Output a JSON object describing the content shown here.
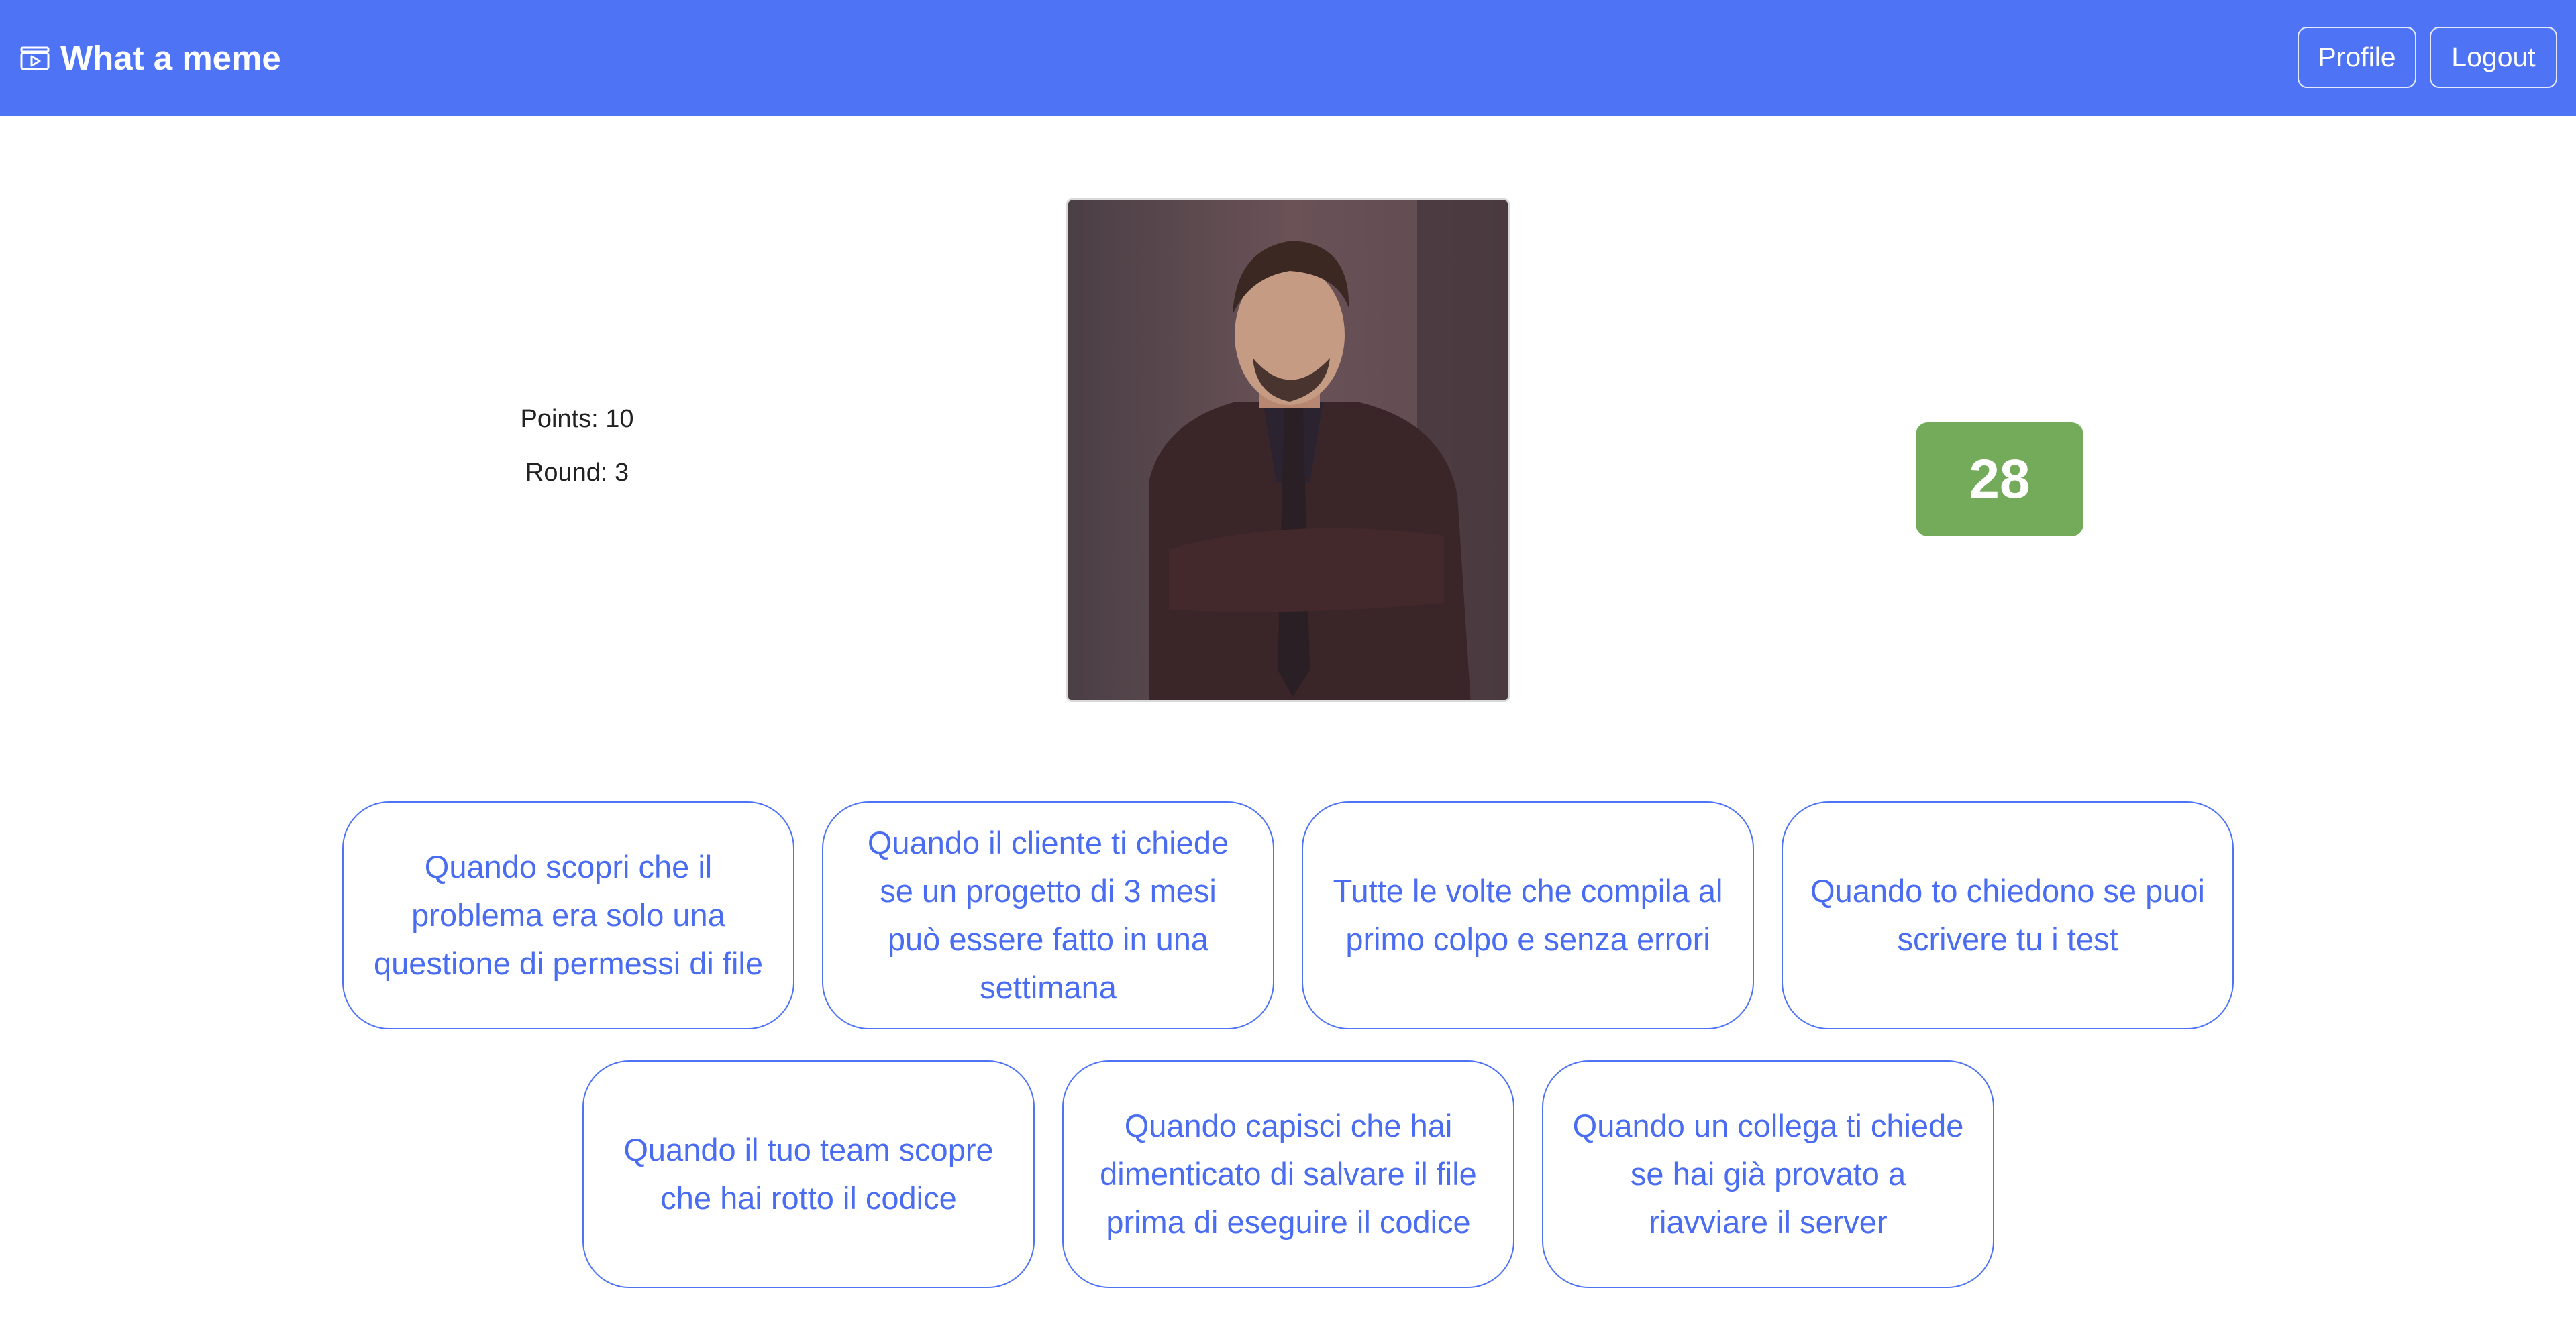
{
  "app": {
    "title": "What a meme",
    "brand_icon": "film-screen-icon",
    "accent_color": "#4f73f5"
  },
  "nav": {
    "profile_label": "Profile",
    "logout_label": "Logout"
  },
  "game": {
    "points_text": "Points: 10",
    "round_text": "Round: 3",
    "timer_value": "28",
    "timer_color": "#73ab5a"
  },
  "captions": [
    "Quando scopri che il problema era solo una questione di permessi di file",
    "Quando il cliente ti chiede se un progetto di 3 mesi può essere fatto in una settimana",
    "Tutte le volte che compila al primo colpo e senza errori",
    "Quando to chiedono se puoi scrivere tu i test",
    "Quando il tuo team scopre che hai rotto il codice",
    "Quando capisci che hai dimenticato di salvare il file prima di eseguire il codice",
    "Quando un collega ti chiede se hai già provato a riavviare il server"
  ]
}
